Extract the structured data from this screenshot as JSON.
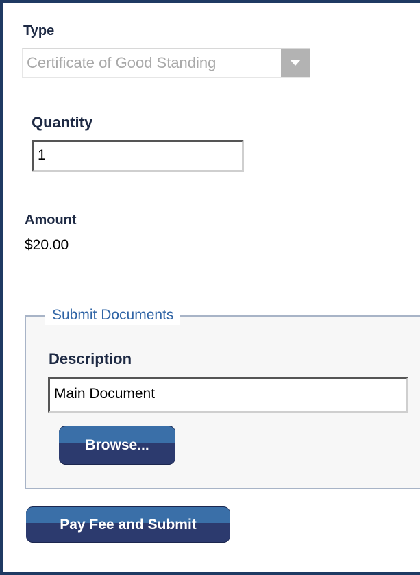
{
  "type_field": {
    "label": "Type",
    "selected_value": "Certificate of Good Standing",
    "dropdown_icon": "chevron-down-icon"
  },
  "quantity_field": {
    "label": "Quantity",
    "value": "1"
  },
  "amount": {
    "label": "Amount",
    "value": "$20.00"
  },
  "submit_documents": {
    "legend": "Submit Documents",
    "description_label": "Description",
    "description_value": "Main Document",
    "browse_label": "Browse..."
  },
  "actions": {
    "pay_submit_label": "Pay Fee and Submit"
  },
  "colors": {
    "frame_border": "#1f3a63",
    "label_text": "#1e2a44",
    "legend_text": "#2f64a5",
    "button_top": "#3a6fa8",
    "button_bottom": "#2c3a6e",
    "fieldset_border": "#a8b4c7",
    "disabled_text": "#a9a9a9"
  }
}
